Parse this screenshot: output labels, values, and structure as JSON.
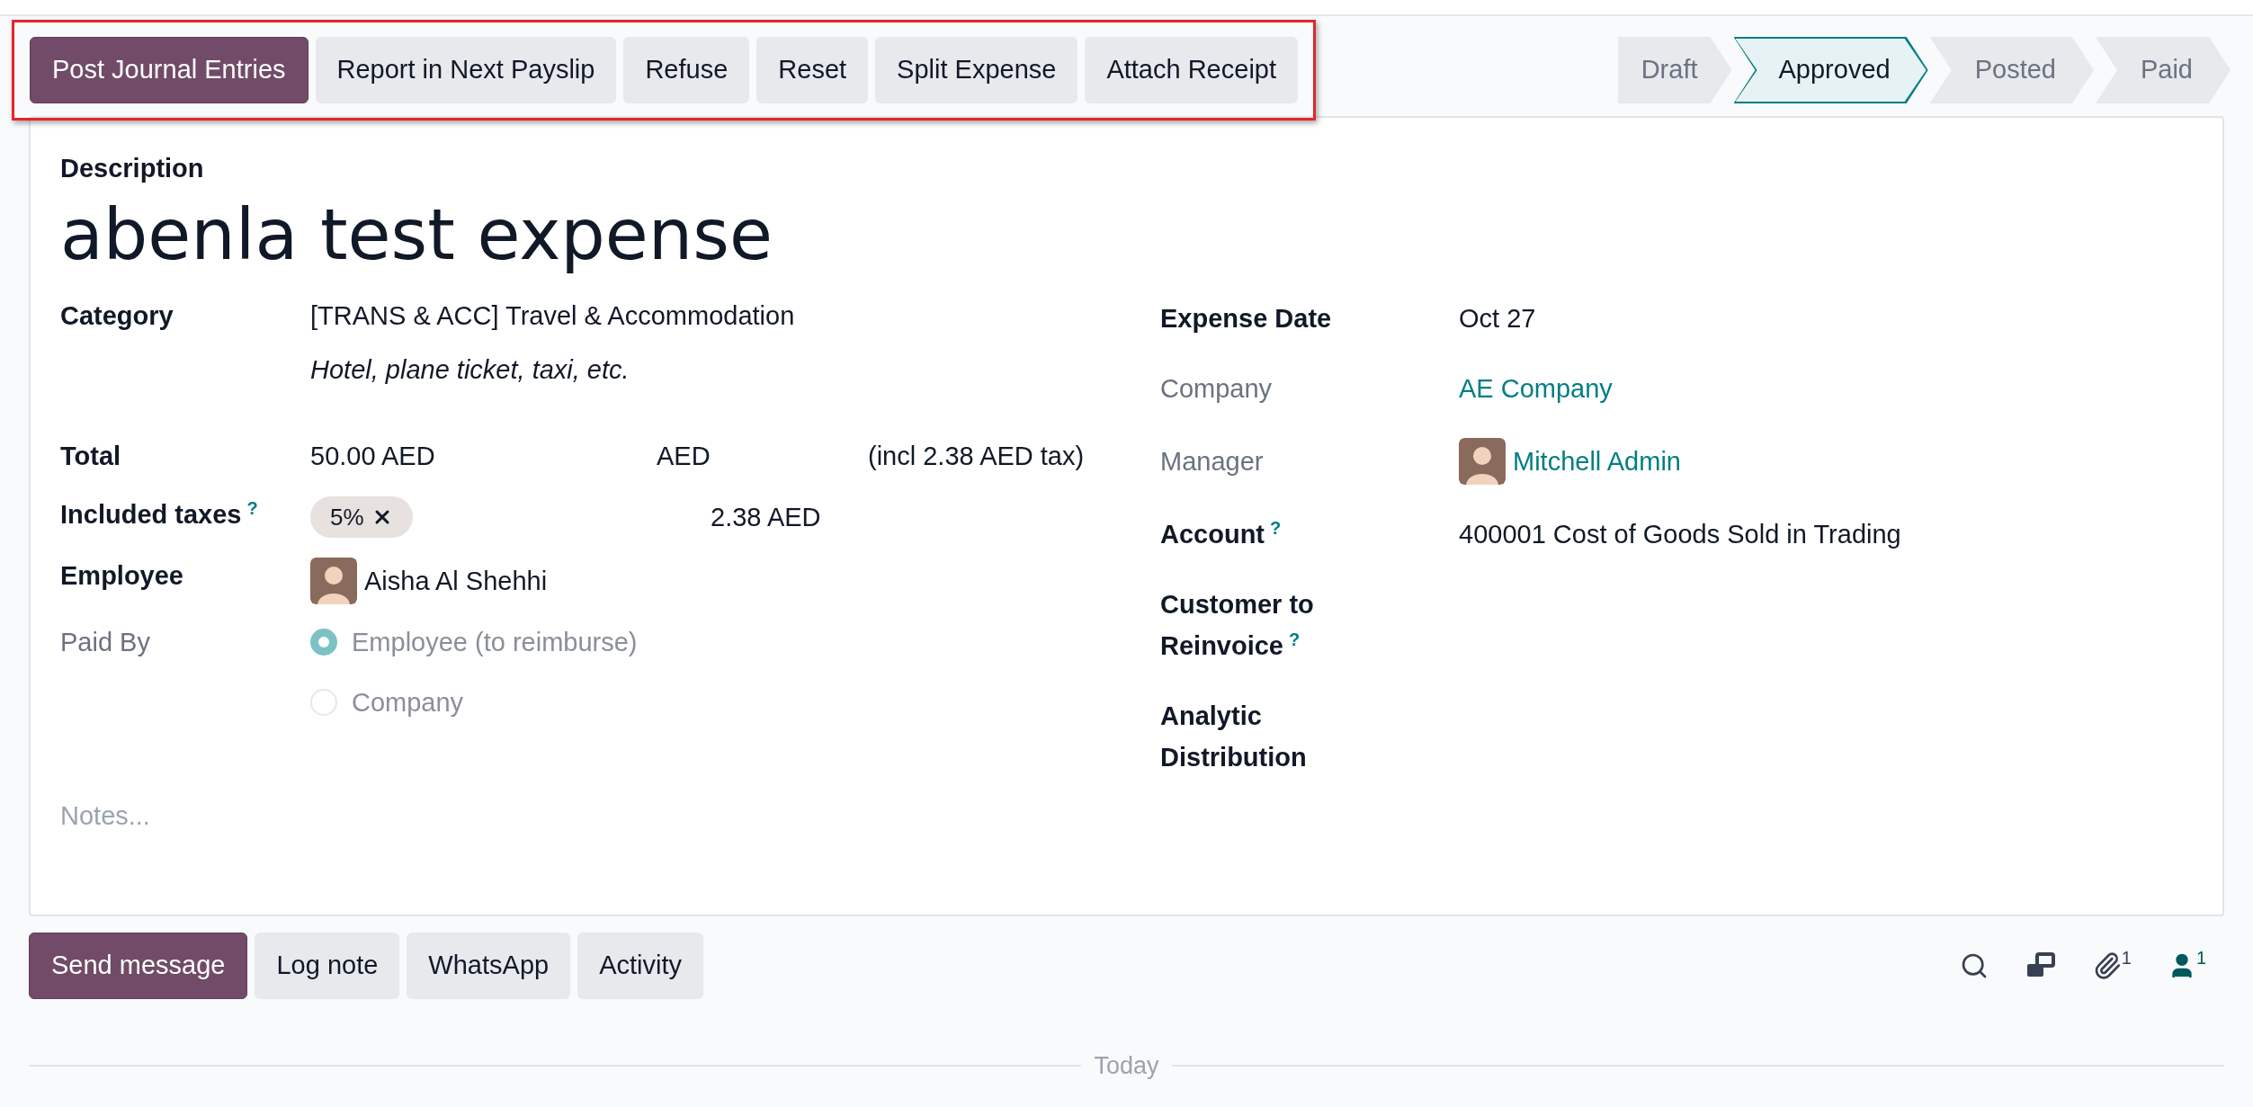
{
  "actions": {
    "highlighted": true,
    "buttons": [
      {
        "label": "Post Journal Entries",
        "primary": true
      },
      {
        "label": "Report in Next Payslip",
        "primary": false
      },
      {
        "label": "Refuse",
        "primary": false
      },
      {
        "label": "Reset",
        "primary": false
      },
      {
        "label": "Split Expense",
        "primary": false
      },
      {
        "label": "Attach Receipt",
        "primary": false
      }
    ]
  },
  "status_steps": [
    {
      "label": "Draft",
      "selected": false
    },
    {
      "label": "Approved",
      "selected": true
    },
    {
      "label": "Posted",
      "selected": false
    },
    {
      "label": "Paid",
      "selected": false
    }
  ],
  "form": {
    "description_label": "Description",
    "title": "abenla test expense",
    "left_fields": [
      {
        "kind": "text",
        "label": "Category",
        "readonly": false,
        "value": "[TRANS & ACC] Travel & Accommodation",
        "note": "Hotel, plane ticket, taxi, etc."
      },
      {
        "kind": "amount",
        "label": "Total",
        "readonly": false,
        "value": "50.00 AED",
        "currency": "AED",
        "tax_note": "(incl 2.38 AED tax)"
      },
      {
        "kind": "tags",
        "label": "Included taxes",
        "help": "?",
        "readonly": false,
        "tags": [
          "5%"
        ],
        "amount": "2.38 AED"
      },
      {
        "kind": "person",
        "label": "Employee",
        "readonly": false,
        "value": "Aisha Al Shehhi",
        "link": false
      },
      {
        "kind": "radio",
        "label": "Paid By",
        "readonly": true,
        "options": [
          {
            "label": "Employee (to reimburse)",
            "selected": true
          },
          {
            "label": "Company",
            "selected": false
          }
        ]
      }
    ],
    "right_fields": [
      {
        "kind": "text",
        "label": "Expense Date",
        "readonly": false,
        "value": "Oct 27"
      },
      {
        "kind": "link",
        "label": "Company",
        "readonly": true,
        "value": "AE Company"
      },
      {
        "kind": "person",
        "label": "Manager",
        "readonly": true,
        "value": "Mitchell Admin",
        "link": true
      },
      {
        "kind": "text",
        "label": "Account",
        "help": "?",
        "readonly": false,
        "value": "400001 Cost of Goods Sold in Trading"
      },
      {
        "kind": "empty",
        "label": "Customer to Reinvoice",
        "help": "?",
        "readonly": false
      },
      {
        "kind": "empty",
        "label": "Analytic Distribution",
        "readonly": false
      }
    ],
    "notes": {
      "placeholder": "Notes..."
    }
  },
  "chatter": {
    "buttons": [
      {
        "label": "Send message",
        "primary": true
      },
      {
        "label": "Log note",
        "primary": false
      },
      {
        "label": "WhatsApp",
        "primary": false
      },
      {
        "label": "Activity",
        "primary": false
      }
    ],
    "icons": [
      {
        "kind": "search"
      },
      {
        "kind": "windows"
      },
      {
        "kind": "attachments",
        "count": "1"
      },
      {
        "kind": "followers",
        "count": "1"
      }
    ],
    "divider_label": "Today"
  }
}
